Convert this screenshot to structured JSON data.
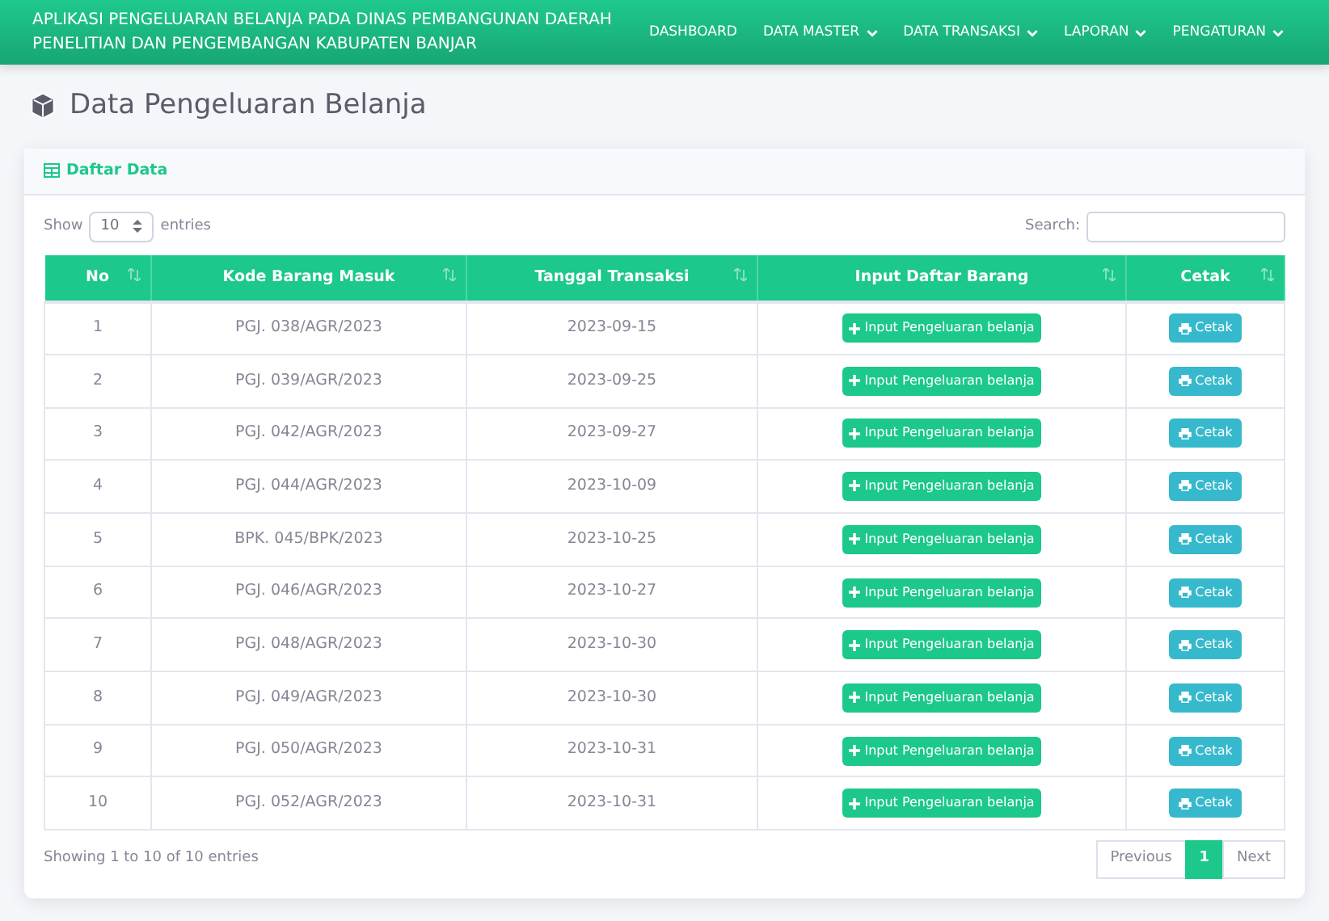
{
  "app_title": "APLIKASI PENGELUARAN BELANJA PADA DINAS PEMBANGUNAN DAERAH PENELITIAN DAN PENGEMBANGAN KABUPATEN BANJAR",
  "nav": [
    {
      "label": "DASHBOARD",
      "dropdown": false
    },
    {
      "label": "DATA MASTER",
      "dropdown": true
    },
    {
      "label": "DATA TRANSAKSI",
      "dropdown": true
    },
    {
      "label": "LAPORAN",
      "dropdown": true
    },
    {
      "label": "PENGATURAN",
      "dropdown": true
    }
  ],
  "page_title": "Data Pengeluaran Belanja",
  "card_title": "Daftar Data",
  "length": {
    "prefix": "Show",
    "value": "10",
    "suffix": "entries"
  },
  "search": {
    "label": "Search:"
  },
  "table": {
    "columns": [
      "No",
      "Kode Barang Masuk",
      "Tanggal Transaksi",
      "Input Daftar Barang",
      "Cetak"
    ],
    "rows": [
      {
        "no": "1",
        "kode": "PGJ. 038/AGR/2023",
        "tanggal": "2023-09-15",
        "input": "Input Pengeluaran belanja",
        "cetak": "Cetak"
      },
      {
        "no": "2",
        "kode": "PGJ. 039/AGR/2023",
        "tanggal": "2023-09-25",
        "input": "Input Pengeluaran belanja",
        "cetak": "Cetak"
      },
      {
        "no": "3",
        "kode": "PGJ. 042/AGR/2023",
        "tanggal": "2023-09-27",
        "input": "Input Pengeluaran belanja",
        "cetak": "Cetak"
      },
      {
        "no": "4",
        "kode": "PGJ. 044/AGR/2023",
        "tanggal": "2023-10-09",
        "input": "Input Pengeluaran belanja",
        "cetak": "Cetak"
      },
      {
        "no": "5",
        "kode": "BPK. 045/BPK/2023",
        "tanggal": "2023-10-25",
        "input": "Input Pengeluaran belanja",
        "cetak": "Cetak"
      },
      {
        "no": "6",
        "kode": "PGJ. 046/AGR/2023",
        "tanggal": "2023-10-27",
        "input": "Input Pengeluaran belanja",
        "cetak": "Cetak"
      },
      {
        "no": "7",
        "kode": "PGJ. 048/AGR/2023",
        "tanggal": "2023-10-30",
        "input": "Input Pengeluaran belanja",
        "cetak": "Cetak"
      },
      {
        "no": "8",
        "kode": "PGJ. 049/AGR/2023",
        "tanggal": "2023-10-30",
        "input": "Input Pengeluaran belanja",
        "cetak": "Cetak"
      },
      {
        "no": "9",
        "kode": "PGJ. 050/AGR/2023",
        "tanggal": "2023-10-31",
        "input": "Input Pengeluaran belanja",
        "cetak": "Cetak"
      },
      {
        "no": "10",
        "kode": "PGJ. 052/AGR/2023",
        "tanggal": "2023-10-31",
        "input": "Input Pengeluaran belanja",
        "cetak": "Cetak"
      }
    ]
  },
  "info": "Showing 1 to 10 of 10 entries",
  "pagination": [
    {
      "label": "Previous",
      "selected": false
    },
    {
      "label": "1",
      "selected": true
    },
    {
      "label": "Next",
      "selected": false
    }
  ]
}
